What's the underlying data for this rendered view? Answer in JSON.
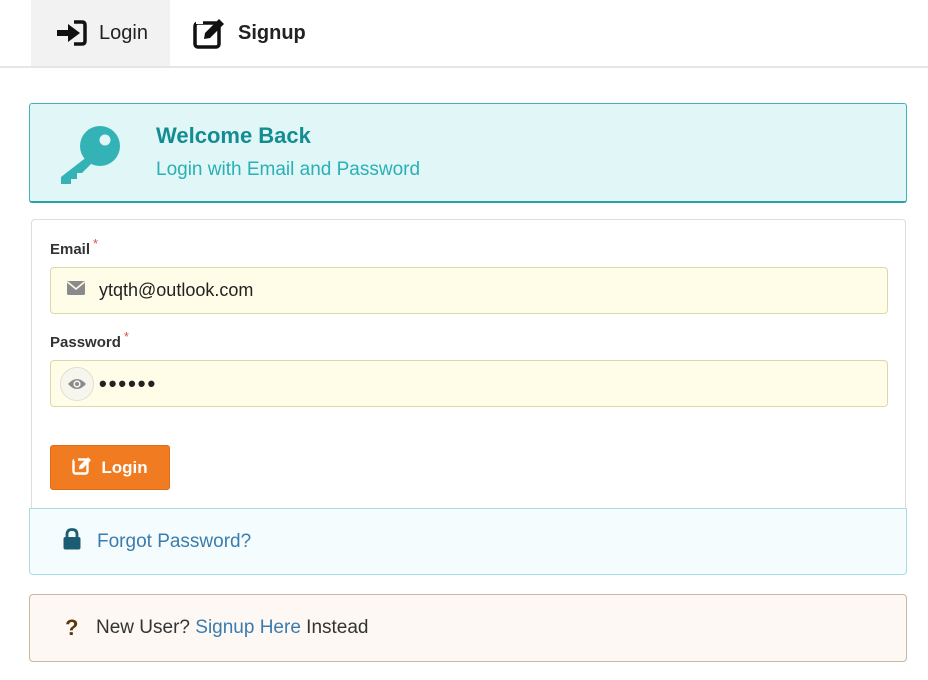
{
  "tabs": {
    "login": {
      "label": "Login",
      "icon": "sign-in-icon",
      "active": true
    },
    "signup": {
      "label": "Signup",
      "icon": "edit-icon"
    }
  },
  "banner": {
    "title": "Welcome Back",
    "subtitle": "Login with Email and Password",
    "icon": "key-icon"
  },
  "form": {
    "email": {
      "label": "Email",
      "required_mark": "*",
      "value": "ytqth@outlook.com",
      "icon": "envelope-icon"
    },
    "password": {
      "label": "Password",
      "required_mark": "*",
      "value": "••••••",
      "icon": "eye-icon"
    },
    "submit": {
      "label": "Login",
      "icon": "edit-icon"
    }
  },
  "forgot": {
    "label": "Forgot Password?",
    "icon": "lock-icon"
  },
  "new_user": {
    "prefix": "New User?",
    "link": "Signup Here",
    "suffix": "Instead",
    "icon": "question-icon"
  },
  "colors": {
    "accent_teal": "#148d92",
    "button_orange": "#f07b20",
    "link_blue": "#3a7cb0"
  }
}
